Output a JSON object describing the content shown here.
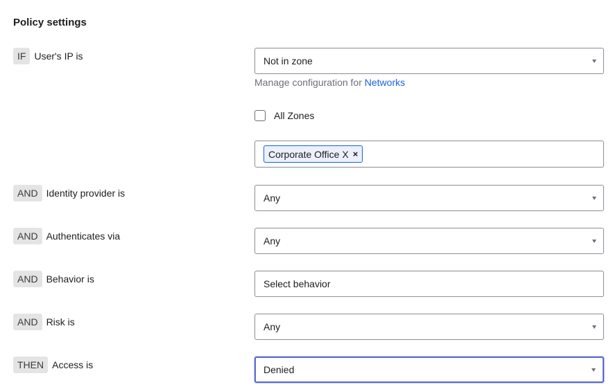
{
  "title": "Policy settings",
  "rows": [
    {
      "badge": "IF",
      "label": "User's IP is",
      "value": "Not in zone"
    },
    {
      "badge": "AND",
      "label": "Identity provider is",
      "value": "Any"
    },
    {
      "badge": "AND",
      "label": "Authenticates via",
      "value": "Any"
    },
    {
      "badge": "AND",
      "label": "Behavior is",
      "value": "Select behavior"
    },
    {
      "badge": "AND",
      "label": "Risk is",
      "value": "Any"
    },
    {
      "badge": "THEN",
      "label": "Access is",
      "value": "Denied"
    }
  ],
  "helper": {
    "text": "Manage configuration for ",
    "link": "Networks"
  },
  "all_zones": {
    "label": "All Zones",
    "checked": false
  },
  "zones": {
    "chip": "Corporate Office X",
    "remove": "×"
  },
  "colors": {
    "accent": "#1662dd",
    "focus": "#5b6ad0",
    "badge_bg": "#e4e4e4"
  }
}
